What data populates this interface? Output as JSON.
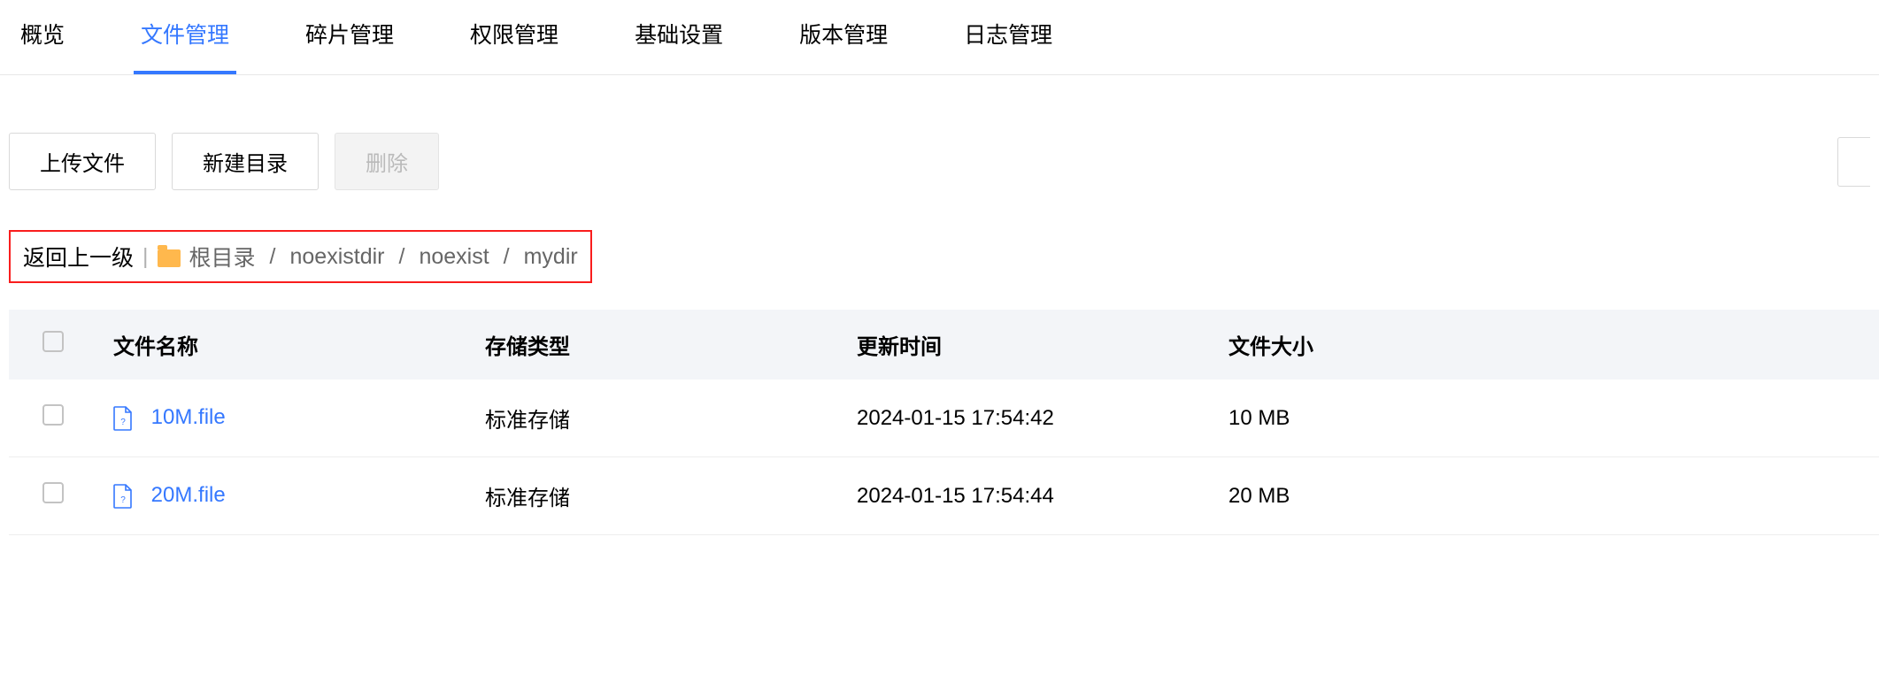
{
  "tabs": [
    {
      "label": "概览",
      "active": false
    },
    {
      "label": "文件管理",
      "active": true
    },
    {
      "label": "碎片管理",
      "active": false
    },
    {
      "label": "权限管理",
      "active": false
    },
    {
      "label": "基础设置",
      "active": false
    },
    {
      "label": "版本管理",
      "active": false
    },
    {
      "label": "日志管理",
      "active": false
    }
  ],
  "toolbar": {
    "upload": "上传文件",
    "new_dir": "新建目录",
    "delete": "删除"
  },
  "breadcrumb": {
    "back": "返回上一级",
    "root": "根目录",
    "path": [
      "noexistdir",
      "noexist",
      "mydir"
    ]
  },
  "table": {
    "headers": {
      "name": "文件名称",
      "type": "存储类型",
      "time": "更新时间",
      "size": "文件大小"
    },
    "rows": [
      {
        "name": "10M.file",
        "type": "标准存储",
        "time": "2024-01-15 17:54:42",
        "size": "10 MB"
      },
      {
        "name": "20M.file",
        "type": "标准存储",
        "time": "2024-01-15 17:54:44",
        "size": "20 MB"
      }
    ]
  }
}
